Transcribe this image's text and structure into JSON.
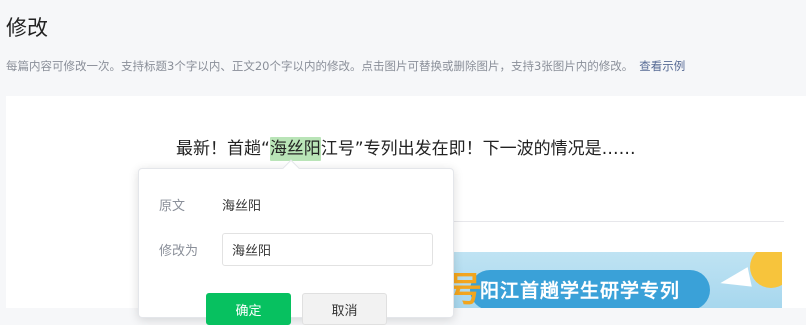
{
  "page": {
    "title": "修改",
    "notice": "每篇内容可修改一次。支持标题3个字以内、正文20个字以内的修改。点击图片可替换或删除图片，支持3张图片内的修改。",
    "example_link": "查看示例"
  },
  "article": {
    "headline_before": "最新！首趟“",
    "headline_highlight": "海丝阳",
    "headline_after": "江号”专列出发在即！下一波的情况是……",
    "banner_text": "阳江首趟学生研学专列",
    "banner_glyph": "号"
  },
  "popover": {
    "original_label": "原文",
    "original_value": "海丝阳",
    "edit_label": "修改为",
    "edit_value": "海丝阳",
    "confirm_label": "确定",
    "cancel_label": "取消"
  },
  "colors": {
    "accent": "#07c160",
    "link": "#576b95",
    "highlight": "#b9e4b7"
  }
}
